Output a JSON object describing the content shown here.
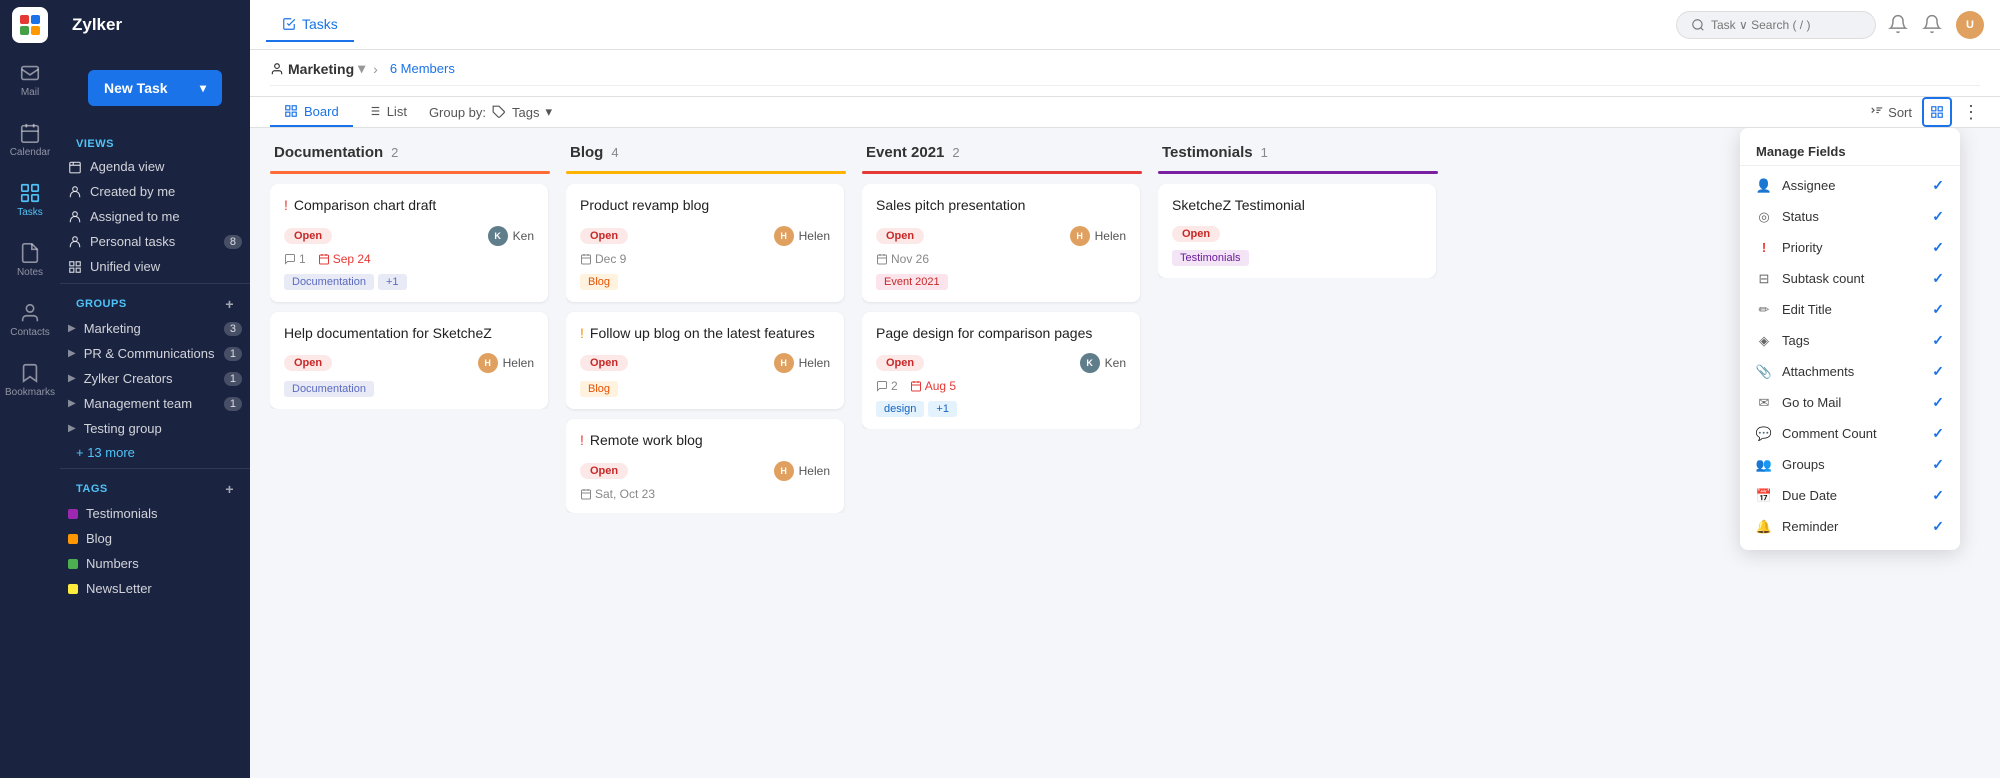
{
  "app": {
    "logo_text": "Zylker",
    "new_task_label": "New Task"
  },
  "topbar": {
    "search_placeholder": "Task ∨  Search ( / )",
    "tab_label": "Tasks"
  },
  "nav": {
    "items": [
      {
        "id": "mail",
        "label": "Mail",
        "active": false
      },
      {
        "id": "calendar",
        "label": "Calendar",
        "active": false
      },
      {
        "id": "tasks",
        "label": "Tasks",
        "active": true
      },
      {
        "id": "notes",
        "label": "Notes",
        "active": false
      },
      {
        "id": "contacts",
        "label": "Contacts",
        "active": false
      },
      {
        "id": "bookmarks",
        "label": "Bookmarks",
        "active": false
      }
    ],
    "views_label": "VIEWS",
    "views": [
      {
        "label": "Agenda view"
      },
      {
        "label": "Created by me"
      },
      {
        "label": "Assigned to me"
      },
      {
        "label": "Personal tasks",
        "count": "8"
      },
      {
        "label": "Unified view"
      }
    ],
    "groups_label": "GROUPS",
    "groups": [
      {
        "label": "Marketing",
        "count": "3"
      },
      {
        "label": "PR & Communications",
        "count": "1"
      },
      {
        "label": "Zylker Creators",
        "count": "1"
      },
      {
        "label": "Management team",
        "count": "1"
      },
      {
        "label": "Testing group",
        "count": ""
      }
    ],
    "more_groups": "+ 13 more",
    "tags_label": "TAGS",
    "tags": [
      {
        "label": "Testimonials",
        "color": "#9c27b0"
      },
      {
        "label": "Blog",
        "color": "#ff9800"
      },
      {
        "label": "Numbers",
        "color": "#4caf50"
      },
      {
        "label": "NewsLetter",
        "color": "#ffeb3b"
      }
    ]
  },
  "board_header": {
    "project_name": "Marketing",
    "members_count": "6 Members",
    "view_tabs": [
      {
        "label": "Board",
        "active": true
      },
      {
        "label": "List",
        "active": false
      }
    ],
    "group_by_label": "Group by:",
    "group_by_value": "Tags",
    "sort_label": "Sort",
    "fields_active": true,
    "more_icon": "⋮"
  },
  "columns": [
    {
      "id": "documentation",
      "title": "Documentation",
      "count": "2",
      "color": "#ff6b35",
      "cards": [
        {
          "title": "Comparison chart draft",
          "priority": "high",
          "status": "Open",
          "assignee_name": "Ken",
          "assignee_color": "#555",
          "comments": "1",
          "date": "Sep 24",
          "date_red": true,
          "tags": [
            {
              "label": "Documentation",
              "color": "#e8eaf6",
              "text_color": "#5c6bc0"
            },
            {
              "label": "+1",
              "color": "#e8eaf6",
              "text_color": "#5c6bc0"
            }
          ]
        },
        {
          "title": "Help documentation for SketcheZ",
          "priority": "none",
          "status": "Open",
          "assignee_name": "Helen",
          "assignee_color": "#e0a060",
          "date": "",
          "date_red": false,
          "tags": [
            {
              "label": "Documentation",
              "color": "#e8eaf6",
              "text_color": "#5c6bc0"
            }
          ]
        }
      ]
    },
    {
      "id": "blog",
      "title": "Blog",
      "count": "4",
      "color": "#ffb300",
      "cards": [
        {
          "title": "Product revamp blog",
          "priority": "none",
          "status": "Open",
          "assignee_name": "Helen",
          "assignee_color": "#e0a060",
          "date": "Dec 9",
          "date_red": false,
          "tags": [
            {
              "label": "Blog",
              "color": "#fff3e0",
              "text_color": "#e65100"
            }
          ]
        },
        {
          "title": "Follow up blog on the latest features",
          "priority": "medium",
          "status": "Open",
          "assignee_name": "Helen",
          "assignee_color": "#e0a060",
          "date": "",
          "date_red": false,
          "tags": [
            {
              "label": "Blog",
              "color": "#fff3e0",
              "text_color": "#e65100"
            }
          ]
        },
        {
          "title": "Remote work blog",
          "priority": "high",
          "status": "Open",
          "assignee_name": "Helen",
          "assignee_color": "#e0a060",
          "date": "Sat, Oct 23",
          "date_red": false,
          "tags": []
        }
      ]
    },
    {
      "id": "event2021",
      "title": "Event 2021",
      "count": "2",
      "color": "#e53935",
      "cards": [
        {
          "title": "Sales pitch presentation",
          "priority": "none",
          "status": "Open",
          "assignee_name": "Helen",
          "assignee_color": "#e0a060",
          "date": "Nov 26",
          "date_red": false,
          "tags": [
            {
              "label": "Event 2021",
              "color": "#fce4ec",
              "text_color": "#c62828"
            }
          ]
        },
        {
          "title": "Page design for comparison pages",
          "priority": "none",
          "status": "Open",
          "assignee_name": "Ken",
          "assignee_color": "#555",
          "comments": "2",
          "date": "Aug 5",
          "date_red": true,
          "tags": [
            {
              "label": "design",
              "color": "#e3f2fd",
              "text_color": "#1565c0"
            },
            {
              "label": "+1",
              "color": "#e3f2fd",
              "text_color": "#1565c0"
            }
          ]
        }
      ]
    },
    {
      "id": "testimonials",
      "title": "Testimonials",
      "count": "1",
      "color": "#7b1fa2",
      "cards": [
        {
          "title": "SketcheZ Testimonial",
          "priority": "none",
          "status": "Open",
          "assignee_name": "",
          "assignee_color": "",
          "date": "",
          "date_red": false,
          "tags": [
            {
              "label": "Testimonials",
              "color": "#f3e5f5",
              "text_color": "#6a1b9a"
            }
          ]
        }
      ]
    }
  ],
  "manage_fields": {
    "title": "Manage Fields",
    "items": [
      {
        "label": "Assignee",
        "icon": "👤",
        "checked": true
      },
      {
        "label": "Status",
        "icon": "◎",
        "checked": true
      },
      {
        "label": "Priority",
        "icon": "!",
        "checked": true
      },
      {
        "label": "Subtask count",
        "icon": "⊟",
        "checked": true
      },
      {
        "label": "Edit Title",
        "icon": "✏",
        "checked": true
      },
      {
        "label": "Tags",
        "icon": "◈",
        "checked": true
      },
      {
        "label": "Attachments",
        "icon": "📎",
        "checked": true
      },
      {
        "label": "Go to Mail",
        "icon": "✉",
        "checked": true
      },
      {
        "label": "Comment Count",
        "icon": "💬",
        "checked": true
      },
      {
        "label": "Groups",
        "icon": "👥",
        "checked": true
      },
      {
        "label": "Due Date",
        "icon": "📅",
        "checked": true
      },
      {
        "label": "Reminder",
        "icon": "🔔",
        "checked": true
      }
    ]
  }
}
